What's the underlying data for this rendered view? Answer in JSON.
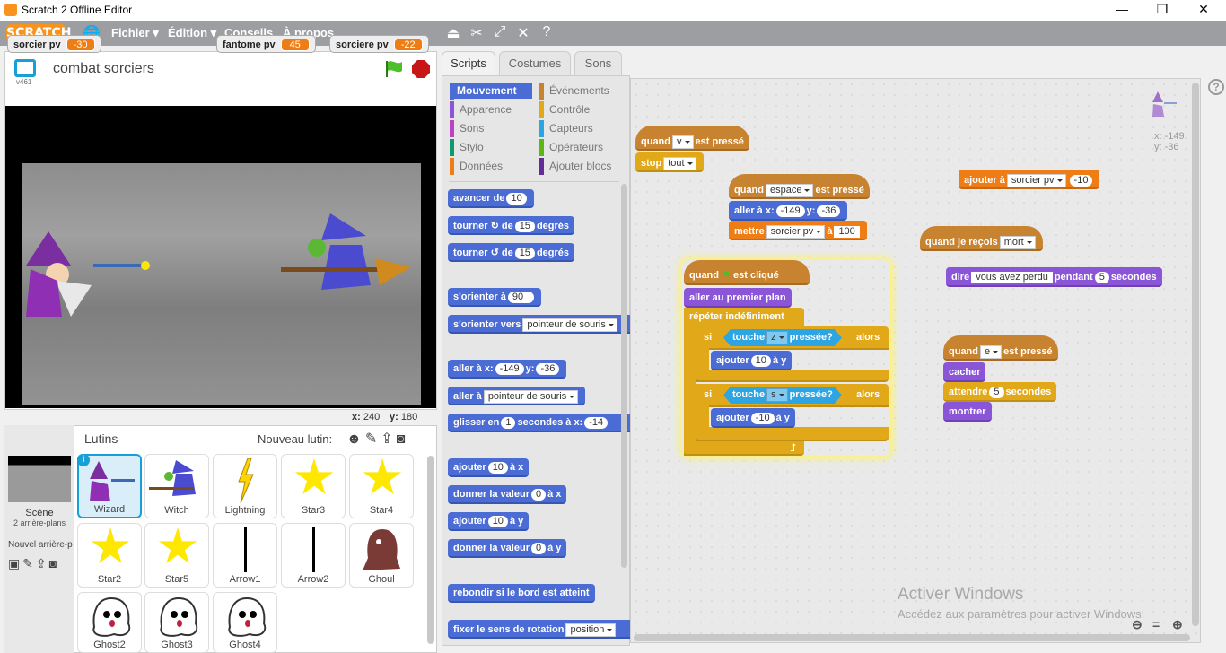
{
  "window": {
    "title": "Scratch 2 Offline Editor"
  },
  "menubar": {
    "logo": "SCRATCH",
    "items": [
      "Fichier ▾",
      "Édition ▾",
      "Conseils",
      "À propos"
    ]
  },
  "stage": {
    "version": "v461",
    "project_title": "combat sorciers",
    "monitors": [
      {
        "label": "sorcier pv",
        "value": "-30"
      },
      {
        "label": "fantome pv",
        "value": "45"
      },
      {
        "label": "sorciere pv",
        "value": "-22"
      }
    ],
    "coords": {
      "x_label": "x:",
      "x": "240",
      "y_label": "y:",
      "y": "180"
    }
  },
  "sprites_panel": {
    "title": "Lutins",
    "new_sprite_label": "Nouveau lutin:",
    "scene_label": "Scène",
    "scene_sub": "2 arrière-plans",
    "new_backdrop_label": "Nouvel arrière-p",
    "sprites": [
      "Wizard",
      "Witch",
      "Lightning",
      "Star3",
      "Star4",
      "Star2",
      "Star5",
      "Arrow1",
      "Arrow2",
      "Ghoul",
      "Ghost2",
      "Ghost3",
      "Ghost4"
    ],
    "selected": "Wizard"
  },
  "tabs": [
    "Scripts",
    "Costumes",
    "Sons"
  ],
  "categories": {
    "left": [
      "Mouvement",
      "Apparence",
      "Sons",
      "Stylo",
      "Données"
    ],
    "right": [
      "Événements",
      "Contrôle",
      "Capteurs",
      "Opérateurs",
      "Ajouter blocs"
    ],
    "colors": {
      "Mouvement": "#4a6cd4",
      "Apparence": "#8a55d7",
      "Sons": "#bb42c3",
      "Stylo": "#0e9a6c",
      "Données": "#ee7d16",
      "Événements": "#c88330",
      "Contrôle": "#e1a91a",
      "Capteurs": "#2ca5e2",
      "Opérateurs": "#5cb712",
      "Ajouter blocs": "#632d99"
    }
  },
  "palette": {
    "b1": [
      "avancer de",
      "10"
    ],
    "b2": [
      "tourner",
      "de",
      "15",
      "degrés"
    ],
    "b3": [
      "tourner",
      "de",
      "15",
      "degrés"
    ],
    "b4": [
      "s'orienter à",
      "90"
    ],
    "b5": [
      "s'orienter vers",
      "pointeur de souris"
    ],
    "b6": [
      "aller à x:",
      "-149",
      "y:",
      "-36"
    ],
    "b7": [
      "aller à",
      "pointeur de souris"
    ],
    "b8": [
      "glisser en",
      "1",
      "secondes à x:",
      "-14"
    ],
    "b9": [
      "ajouter",
      "10",
      "à x"
    ],
    "b10": [
      "donner la valeur",
      "0",
      "à x"
    ],
    "b11": [
      "ajouter",
      "10",
      "à y"
    ],
    "b12": [
      "donner la valeur",
      "0",
      "à y"
    ],
    "b13": "rebondir si le bord est atteint",
    "b14": [
      "fixer le sens de rotation",
      "position"
    ]
  },
  "scripts": {
    "s1": {
      "hat": [
        "quand",
        "v",
        "est pressé"
      ],
      "stop": [
        "stop",
        "tout"
      ]
    },
    "s2": {
      "hat": [
        "quand",
        "espace",
        "est pressé"
      ],
      "goto": [
        "aller à x:",
        "-149",
        "y:",
        "-36"
      ],
      "set": [
        "mettre",
        "sorcier pv",
        "à",
        "100"
      ]
    },
    "s3": {
      "hat": [
        "quand",
        "est cliqué"
      ],
      "front": "aller au premier plan",
      "forever": "répéter indéfiniment",
      "if1": [
        "si",
        "touche",
        "z",
        "pressée?",
        "alors"
      ],
      "add1": [
        "ajouter",
        "10",
        "à y"
      ],
      "if2": [
        "si",
        "touche",
        "s",
        "pressée?",
        "alors"
      ],
      "add2": [
        "ajouter",
        "-10",
        "à y"
      ]
    },
    "s4": [
      "ajouter à",
      "sorcier pv",
      "-10"
    ],
    "s5": {
      "hat": [
        "quand je reçois",
        "mort"
      ],
      "say": [
        "dire",
        "vous avez perdu",
        "pendant",
        "5",
        "secondes"
      ]
    },
    "s6": {
      "hat": [
        "quand",
        "e",
        "est pressé"
      ],
      "hide": "cacher",
      "wait": [
        "attendre",
        "5",
        "secondes"
      ],
      "show": "montrer"
    },
    "sprite_pos": {
      "x": "x: -149",
      "y": "y: -36"
    }
  },
  "watermark": {
    "title": "Activer Windows",
    "sub": "Accédez aux paramètres pour activer Windows."
  }
}
